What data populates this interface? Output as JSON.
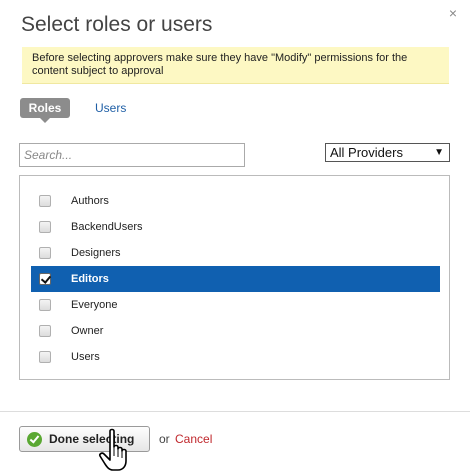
{
  "dialog": {
    "title": "Select roles or users",
    "close_icon": "×",
    "notice": "Before selecting approvers make sure they have \"Modify\" permissions for the content subject to approval"
  },
  "tabs": [
    {
      "label": "Roles",
      "active": true
    },
    {
      "label": "Users",
      "active": false
    }
  ],
  "search": {
    "placeholder": "Search...",
    "value": ""
  },
  "provider": {
    "selected": "All Providers",
    "caret": "▼"
  },
  "roles": [
    {
      "label": "Authors",
      "checked": false,
      "selected": false
    },
    {
      "label": "BackendUsers",
      "checked": false,
      "selected": false
    },
    {
      "label": "Designers",
      "checked": false,
      "selected": false
    },
    {
      "label": "Editors",
      "checked": true,
      "selected": true
    },
    {
      "label": "Everyone",
      "checked": false,
      "selected": false
    },
    {
      "label": "Owner",
      "checked": false,
      "selected": false
    },
    {
      "label": "Users",
      "checked": false,
      "selected": false
    }
  ],
  "footer": {
    "done_label": "Done selecting",
    "or_text": "or",
    "cancel_label": "Cancel"
  },
  "colors": {
    "selection": "#1060b0",
    "notice_bg": "#fdf8c3",
    "cancel": "#c0282d",
    "link": "#1f5fa6"
  },
  "icons": {
    "close": "close-icon",
    "done": "check-circle-icon",
    "pointer": "hand-pointer-icon"
  }
}
